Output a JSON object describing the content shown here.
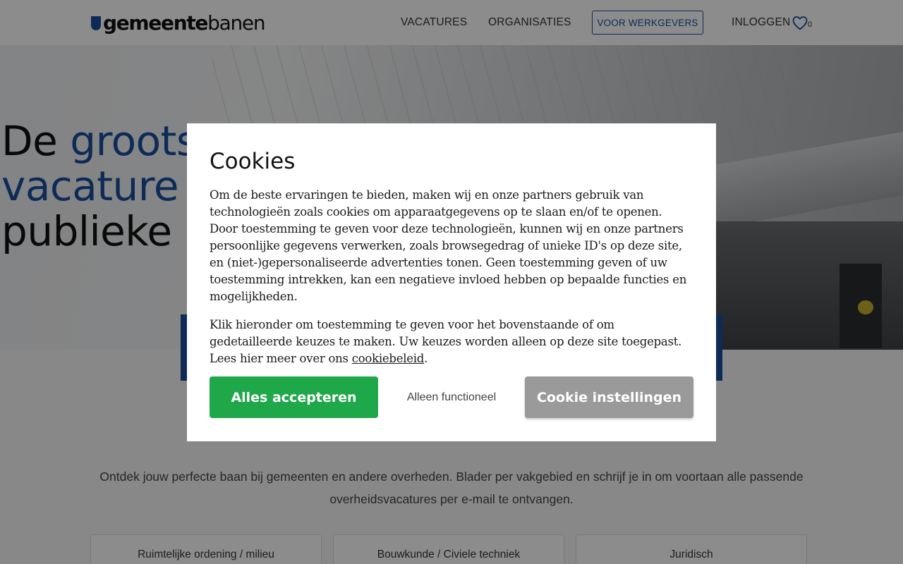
{
  "header": {
    "logo_bold": "gemeente",
    "logo_light": "banen",
    "nav": {
      "vacatures": "VACATURES",
      "organisaties": "ORGANISATIES",
      "voor_werkgevers": "VOOR WERKGEVERS",
      "inloggen": "INLOGGEN"
    },
    "favorites_count": "0"
  },
  "hero": {
    "headline_1": "De ",
    "headline_1_blue": "groots",
    "headline_2_blue": "vacature",
    "headline_3": "publieke"
  },
  "intro": {
    "text": "Ontdek jouw perfecte baan bij gemeenten en andere overheden. Blader per vakgebied en schrijf je in om voortaan alle passende overheidsvacatures per e-mail te ontvangen."
  },
  "categories": [
    {
      "label": "Ruimtelijke ordening / milieu"
    },
    {
      "label": "Bouwkunde / Civiele techniek"
    },
    {
      "label": "Juridisch"
    }
  ],
  "cookie_modal": {
    "title": "Cookies",
    "paragraph_1": "Om de beste ervaringen te bieden, maken wij en onze partners gebruik van technologieën zoals cookies om apparaatgegevens op te slaan en/of te openen. Door toestemming te geven voor deze technologieën, kunnen wij en onze partners persoonlijke gegevens verwerken, zoals browsegedrag of unieke ID's op deze site, en (niet-)gepersonaliseerde advertenties tonen. Geen toestemming geven of uw toestemming intrekken, kan een negatieve invloed hebben op bepaalde functies en mogelijkheden.",
    "paragraph_2": "Klik hieronder om toestemming te geven voor het bovenstaande of om gedetailleerde keuzes te maken. Uw keuzes worden alleen op deze site toegepast. Lees hier meer over ons ",
    "policy_link": "cookiebeleid",
    "paragraph_2_end": ".",
    "accept_label": "Alles accepteren",
    "functional_label": "Alleen functioneel",
    "settings_label": "Cookie instellingen"
  },
  "colors": {
    "brand_blue": "#1a4fa0",
    "accept_green": "#1fa84a",
    "settings_gray": "#9a9a9a"
  }
}
